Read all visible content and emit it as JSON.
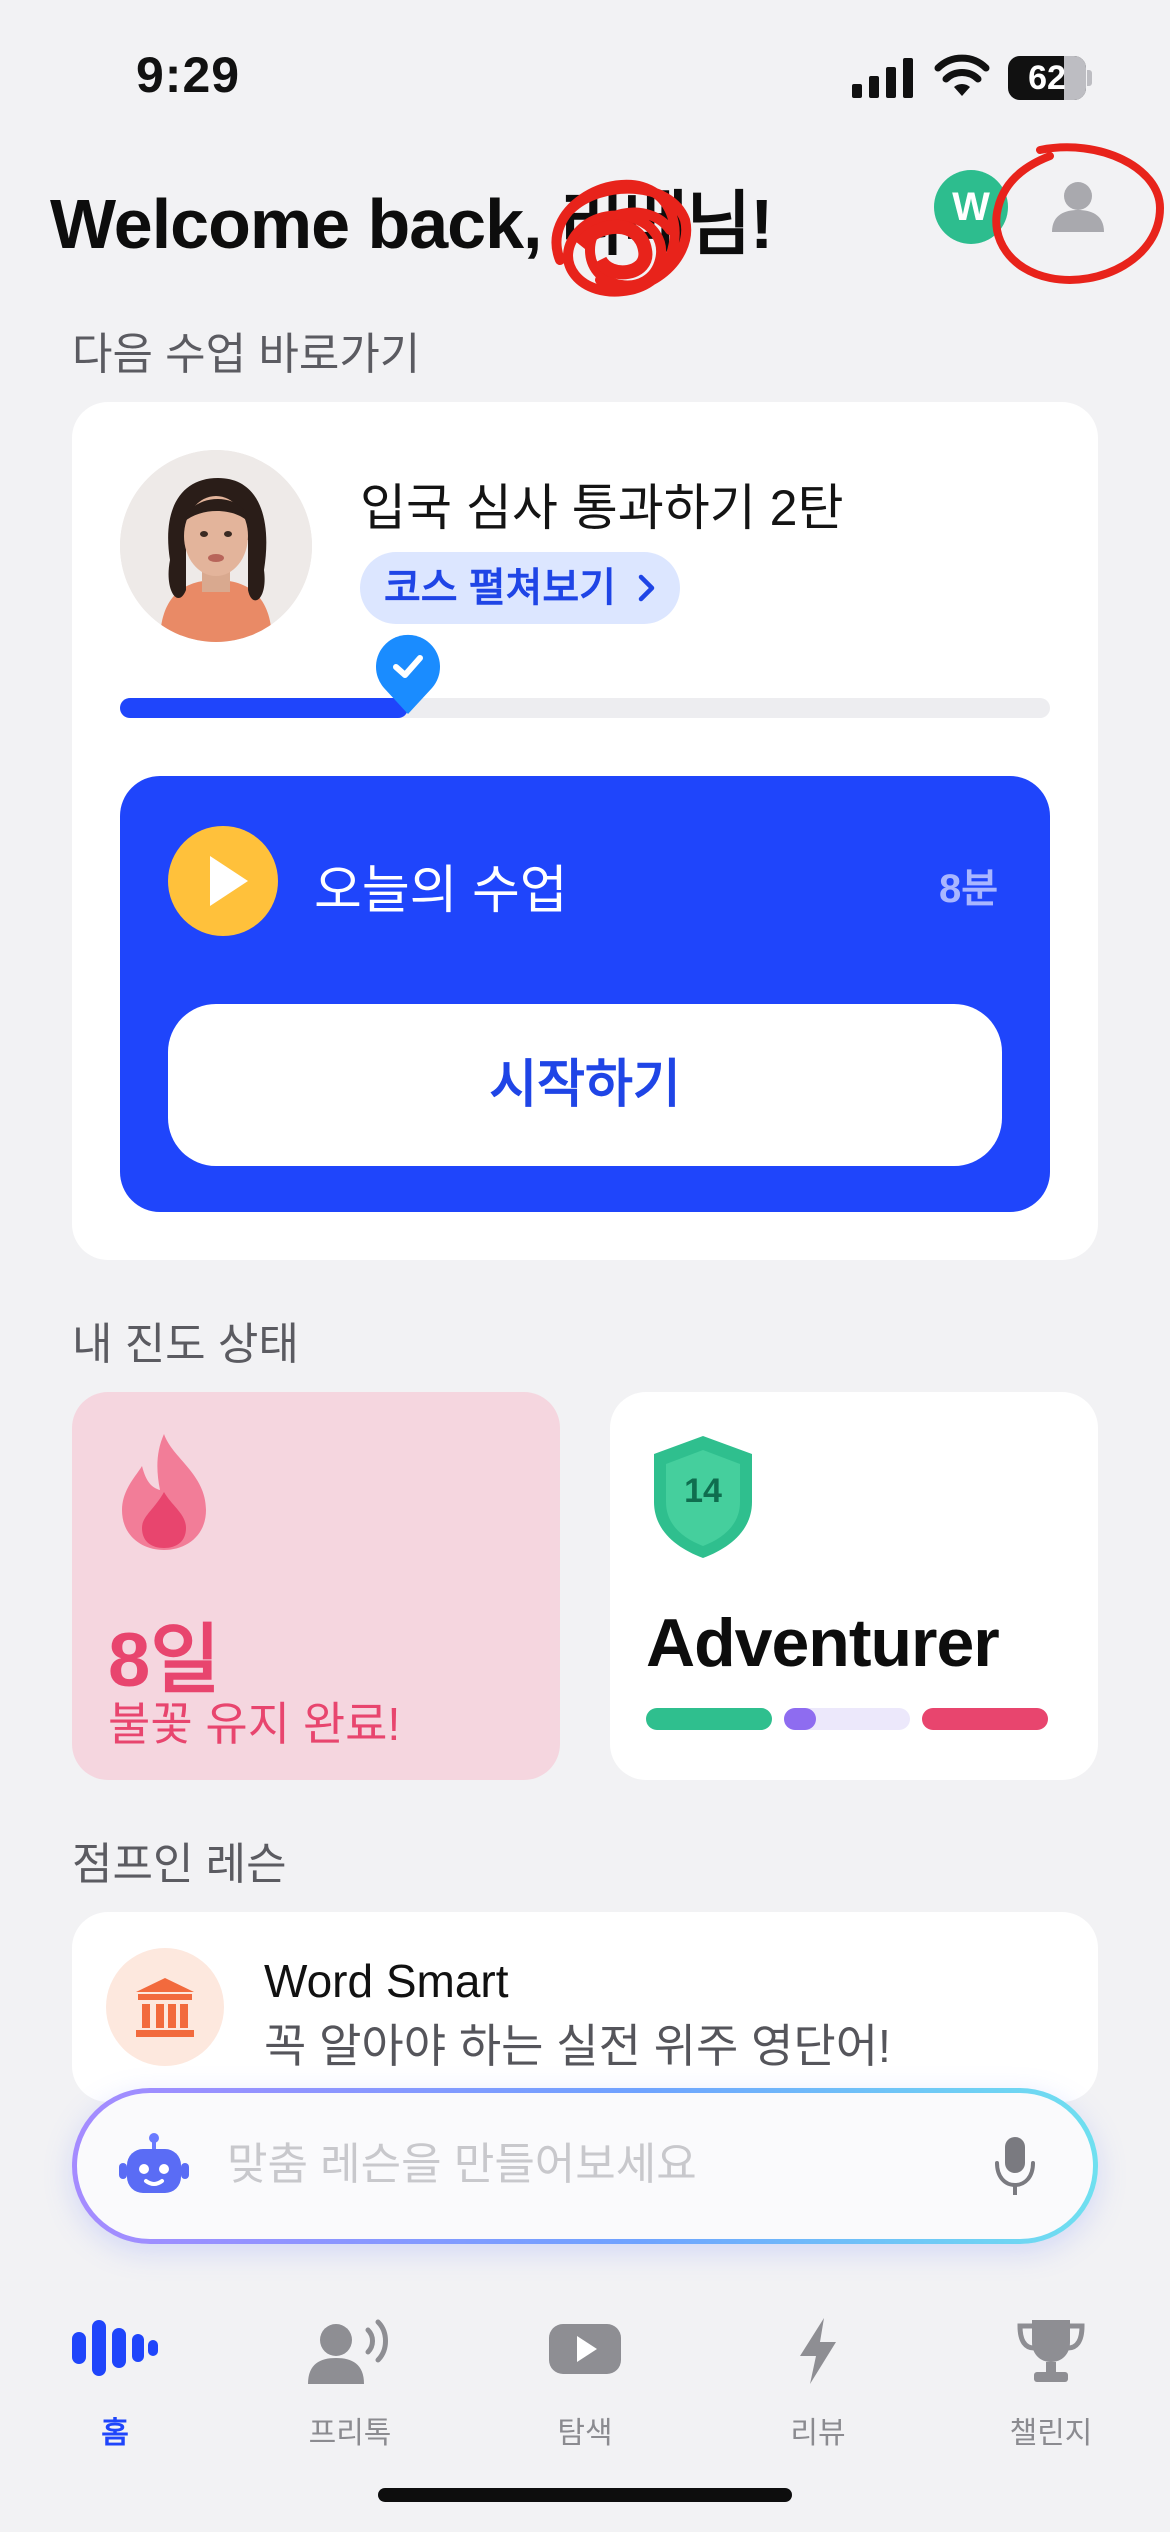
{
  "status_bar": {
    "time": "9:29",
    "battery": "62"
  },
  "header": {
    "welcome": "Welcome back, 리베님!",
    "coin_label": "W"
  },
  "sections": {
    "next_lesson": "다음 수업 바로가기",
    "progress": "내 진도 상태",
    "jump_in": "점프인 레슨"
  },
  "lesson": {
    "title": "입국 심사 통과하기 2탄",
    "course_link": "코스 펼쳐보기",
    "progress_fraction": 0.31,
    "today_label": "오늘의 수업",
    "duration": "8분",
    "start_button": "시작하기"
  },
  "streak": {
    "days": "8일",
    "message": "불꽃 유지 완료!"
  },
  "level": {
    "number": "14",
    "name": "Adventurer",
    "bars": [
      {
        "color": "#2fbf8e",
        "fill": 1.0
      },
      {
        "color": "#8e6cf0",
        "fill": 0.25
      },
      {
        "color": "#e8456e",
        "fill": 1.0
      }
    ]
  },
  "jump_in": {
    "title": "Word Smart",
    "subtitle": "꼭 알아야 하는 실전 위주 영단어!"
  },
  "prompt": {
    "placeholder": "맞춤 레슨을 만들어보세요"
  },
  "tabs": [
    {
      "label": "홈",
      "icon": "voice-wave-icon",
      "active": true
    },
    {
      "label": "프리톡",
      "icon": "freetalk-icon",
      "active": false
    },
    {
      "label": "탐색",
      "icon": "play-icon",
      "active": false
    },
    {
      "label": "리뷰",
      "icon": "lightning-icon",
      "active": false
    },
    {
      "label": "챌린지",
      "icon": "trophy-icon",
      "active": false
    }
  ],
  "colors": {
    "accent": "#1f45fb",
    "play": "#ffc13b",
    "streak_bg": "#f5d6df",
    "streak_text": "#e8456e",
    "coin": "#2dbd8e"
  }
}
